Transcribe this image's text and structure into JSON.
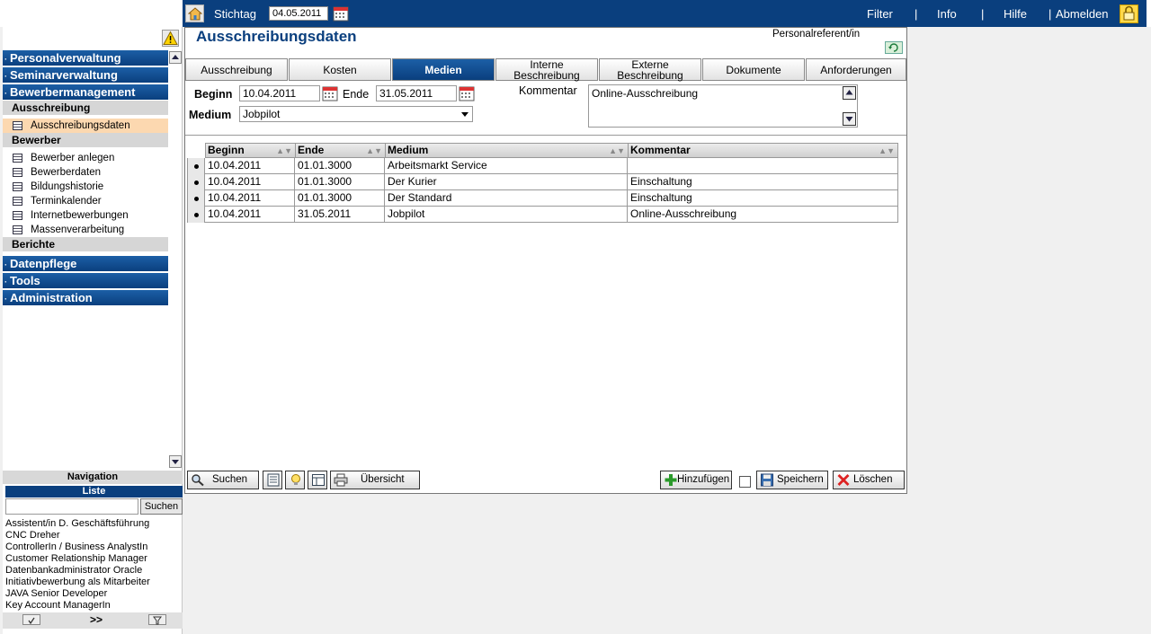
{
  "topbar": {
    "stichtag_label": "Stichtag",
    "stichtag_value": "04.05.2011",
    "nav": [
      "Filter",
      "Info",
      "Hilfe",
      "Abmelden"
    ],
    "separators": [
      "|",
      "|",
      "|"
    ]
  },
  "sidebar": {
    "main_items": [
      "Personalverwaltung",
      "Seminarverwaltung",
      "Bewerbermanagement"
    ],
    "dot": "·",
    "sub_ausschreibung": "Ausschreibung",
    "ausschreibung_items": [
      "Ausschreibungsdaten"
    ],
    "sub_bewerber": "Bewerber",
    "bewerber_items": [
      "Bewerber anlegen",
      "Bewerberdaten",
      "Bildungshistorie",
      "Terminkalender",
      "Internetbewerbungen",
      "Massenverarbeitung"
    ],
    "sub_berichte": "Berichte",
    "bottom_items": [
      "Datenpflege",
      "Tools",
      "Administration"
    ],
    "footer_label": "Navigation"
  },
  "liste": {
    "title": "Liste",
    "search_button": "Suchen",
    "search_value": "",
    "items": [
      "Assistent/in D. Geschäftsführung",
      "CNC Dreher",
      "ControllerIn / Business AnalystIn",
      "Customer Relationship Manager",
      "Datenbankadministrator Oracle",
      "Initiativbewerbung als Mitarbeiter",
      "JAVA Senior Developer",
      "Key Account ManagerIn"
    ],
    "more_label": ">>"
  },
  "main": {
    "title": "Ausschreibungsdaten",
    "role": "Personalreferent/in",
    "tabs": [
      {
        "label": "Ausschreibung"
      },
      {
        "label": "Kosten"
      },
      {
        "label": "Medien",
        "active": true
      },
      {
        "label": "Interne Beschreibung"
      },
      {
        "label": "Externe Beschreibung"
      },
      {
        "label": "Dokumente"
      },
      {
        "label": "Anforderungen"
      }
    ],
    "form": {
      "beginn_label": "Beginn",
      "beginn_value": "10.04.2011",
      "ende_label": "Ende",
      "ende_value": "31.05.2011",
      "medium_label": "Medium",
      "medium_value": "Jobpilot",
      "kommentar_label": "Kommentar",
      "kommentar_value": "Online-Ausschreibung"
    },
    "table": {
      "headers": [
        "Beginn",
        "Ende",
        "Medium",
        "Kommentar"
      ],
      "sort_glyph": "▲▼",
      "rows": [
        [
          "10.04.2011",
          "01.01.3000",
          "Arbeitsmarkt Service",
          ""
        ],
        [
          "10.04.2011",
          "01.01.3000",
          "Der Kurier",
          "Einschaltung"
        ],
        [
          "10.04.2011",
          "01.01.3000",
          "Der Standard",
          "Einschaltung"
        ],
        [
          "10.04.2011",
          "31.05.2011",
          "Jobpilot",
          "Online-Ausschreibung"
        ]
      ]
    },
    "toolbar": {
      "search": "Suchen",
      "overview": "Übersicht",
      "add": "Hinzufügen",
      "save": "Speichern",
      "delete": "Löschen"
    }
  },
  "colors": {
    "brand": "#0a3f7e",
    "active_item": "#fcd8b0"
  }
}
